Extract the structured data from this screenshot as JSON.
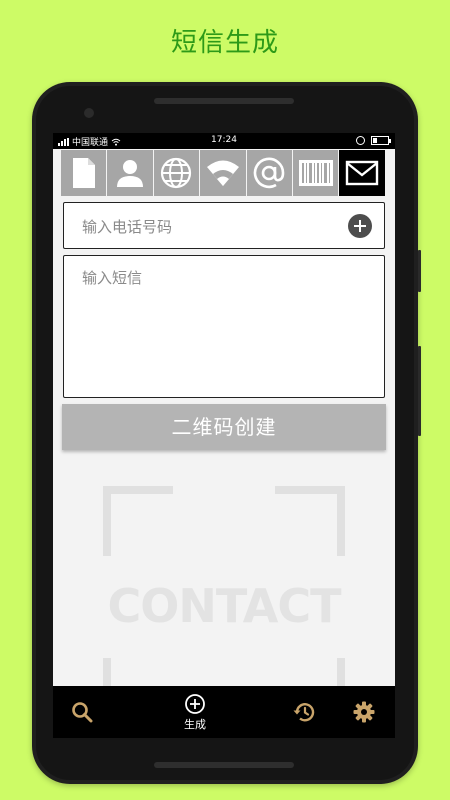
{
  "promo": {
    "title": "短信生成"
  },
  "status_bar": {
    "carrier": "中国联通",
    "time": "17:24"
  },
  "tabs": [
    {
      "icon": "document-icon",
      "active": false
    },
    {
      "icon": "person-icon",
      "active": false
    },
    {
      "icon": "globe-icon",
      "active": false
    },
    {
      "icon": "wifi-icon",
      "active": false
    },
    {
      "icon": "at-sign-icon",
      "active": false
    },
    {
      "icon": "barcode-icon",
      "active": false
    },
    {
      "icon": "envelope-icon",
      "active": true
    }
  ],
  "form": {
    "phone_placeholder": "输入电话号码",
    "sms_placeholder": "输入短信",
    "create_button": "二维码创建"
  },
  "placeholder_graphic": {
    "word": "CONTACT"
  },
  "bottom_nav": {
    "generate_label": "生成"
  },
  "colors": {
    "background": "#cdfb66",
    "title": "#2d9a18",
    "tab_inactive": "#a6a6a6",
    "tab_active": "#000000",
    "nav_icon": "#c9a46a"
  }
}
